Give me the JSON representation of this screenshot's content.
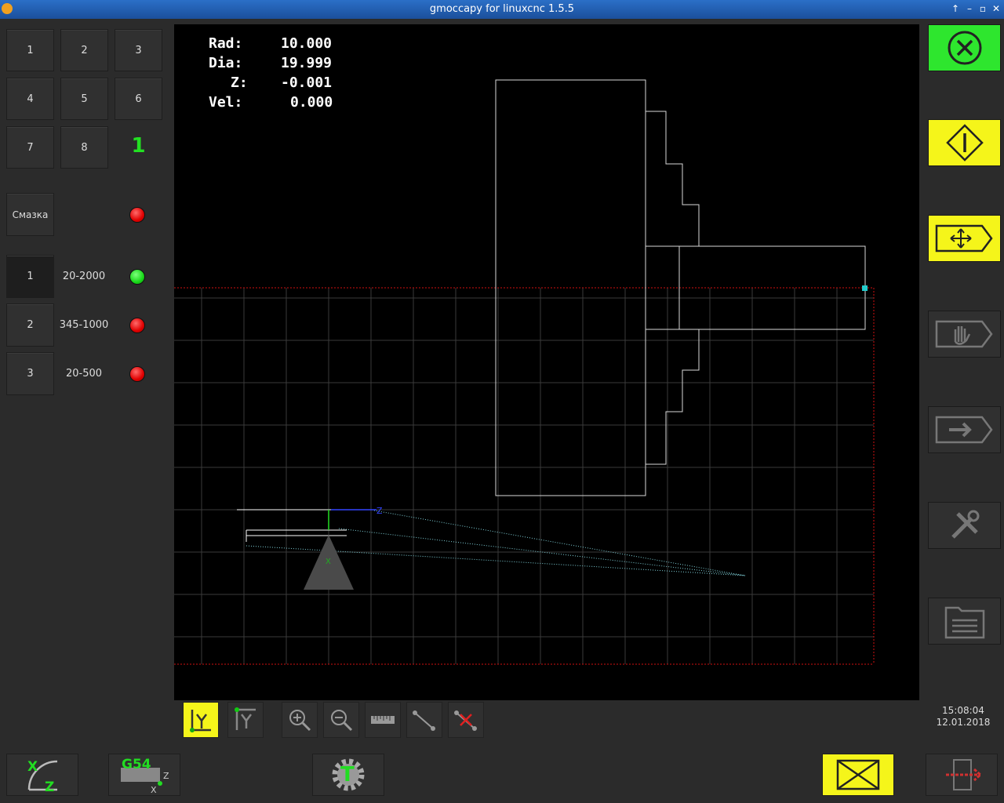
{
  "window": {
    "title": "gmoccapy for linuxcnc  1.5.5"
  },
  "tool_buttons": [
    "1",
    "2",
    "3",
    "4",
    "5",
    "6",
    "7",
    "8"
  ],
  "current_tool": "1",
  "lube": {
    "label": "Смазка",
    "status": "red"
  },
  "spindle_ranges": [
    {
      "gear": "1",
      "range": "20-2000",
      "status": "green"
    },
    {
      "gear": "2",
      "range": "345-1000",
      "status": "red"
    },
    {
      "gear": "3",
      "range": "20-500",
      "status": "red"
    }
  ],
  "dro": {
    "rad_label": "Rad:",
    "rad_value": "10.000",
    "dia_label": "Dia:",
    "dia_value": "19.999",
    "z_label": "Z:",
    "z_value": "-0.001",
    "vel_label": "Vel:",
    "vel_value": "0.000"
  },
  "plot": {
    "axis_z_label": "Z",
    "axis_x_label": "X"
  },
  "toolbar": [
    "view-y-icon",
    "view-y2-icon",
    "zoom-in-icon",
    "zoom-out-icon",
    "measure-icon",
    "toolpath-icon",
    "clear-plot-icon"
  ],
  "right_panel": [
    "estop-button",
    "power-button",
    "manual-mode-button",
    "mdi-mode-button",
    "auto-mode-button",
    "settings-button",
    "user-tabs-button"
  ],
  "clock": {
    "time": "15:08:04",
    "date": "12.01.2018"
  },
  "bottom_bar": {
    "offset_label": "G54",
    "tool_letter": "T"
  },
  "colors": {
    "active_yellow": "#f5f51a",
    "estop_green": "#22ee22",
    "dro_text": "#ffffff"
  }
}
